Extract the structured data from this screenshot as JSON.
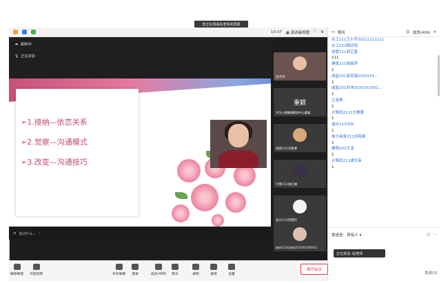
{
  "window": {
    "banner": "您正在观看赵老师的屏幕",
    "time": "10:37",
    "view_mode": "演讲者视图"
  },
  "stage": {
    "recording": "录制中",
    "speaking": "正在讲话:",
    "footer_text": "说点什么..."
  },
  "slide": {
    "bullets": [
      "➢1.接纳—依恋关系",
      "➢2.觉察—沟通模式",
      "➢3.改变—沟通技巧"
    ]
  },
  "participants": [
    {
      "label": "赵老师"
    },
    {
      "label": "重颖",
      "big": true
    },
    {
      "label": "学生心理健康教育中心重颖"
    },
    {
      "label": "福建191邓嘉惠"
    },
    {
      "label": "计算152徐红琳"
    },
    {
      "label": "会计214周慧玲"
    },
    {
      "label": "临床212刘永彬2021061000011"
    }
  ],
  "chat": {
    "tab_chat": "聊天",
    "tab_members": "成员(499)",
    "messages": [
      "水工211王小宇20211111111",
      "水工212顾欣雨",
      "信管211郝芷香",
      "111",
      "建筑211徐晨萍",
      "1",
      "成监201张钧涵2020101...",
      "1",
      "成监201刘洋2020101002...",
      "1",
      "王金杨",
      "1",
      "计算机2111方静雯",
      "1",
      "造价213冯众",
      "1",
      "电子商务211刘芮嵘",
      "1",
      "建筑202王淳",
      "1",
      "计算机211谭文英",
      "1"
    ],
    "send_to_label": "发送至:",
    "send_to_value": "所有人",
    "toast": "正在讲话: 赵老师",
    "send_button": "发送(S)"
  },
  "toolbar": {
    "items": [
      "解除静音",
      "开启视频",
      "共享屏幕",
      "邀请",
      "成员(499)",
      "聊天",
      "录制",
      "表情",
      "设置"
    ],
    "leave": "离开会议"
  },
  "colors": {
    "slide_text": "#c2497a",
    "accent_blue": "#2d6fd6",
    "leave_red": "#e34"
  }
}
